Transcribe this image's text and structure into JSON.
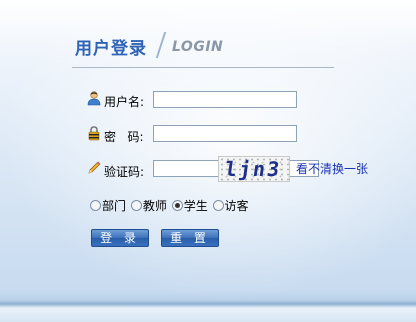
{
  "header": {
    "title_cn": "用户登录",
    "title_en": "LOGIN"
  },
  "form": {
    "username": {
      "label": "用户名:",
      "value": "",
      "icon": "user-icon"
    },
    "password": {
      "label": "密   码:",
      "value": "",
      "icon": "lock-icon"
    },
    "captcha": {
      "label": "验证码:",
      "value": "",
      "icon": "pencil-icon",
      "image_text": "ljn3",
      "refresh_label": "看不清换一张"
    },
    "roles": [
      {
        "label": "部门",
        "checked": false
      },
      {
        "label": "教师",
        "checked": false
      },
      {
        "label": "学生",
        "checked": true
      },
      {
        "label": "访客",
        "checked": false
      }
    ]
  },
  "buttons": {
    "login_label": "登 录",
    "reset_label": "重 置"
  },
  "colors": {
    "title": "#2f63b6",
    "link": "#1a33b0",
    "button": "#3b6fb9"
  }
}
